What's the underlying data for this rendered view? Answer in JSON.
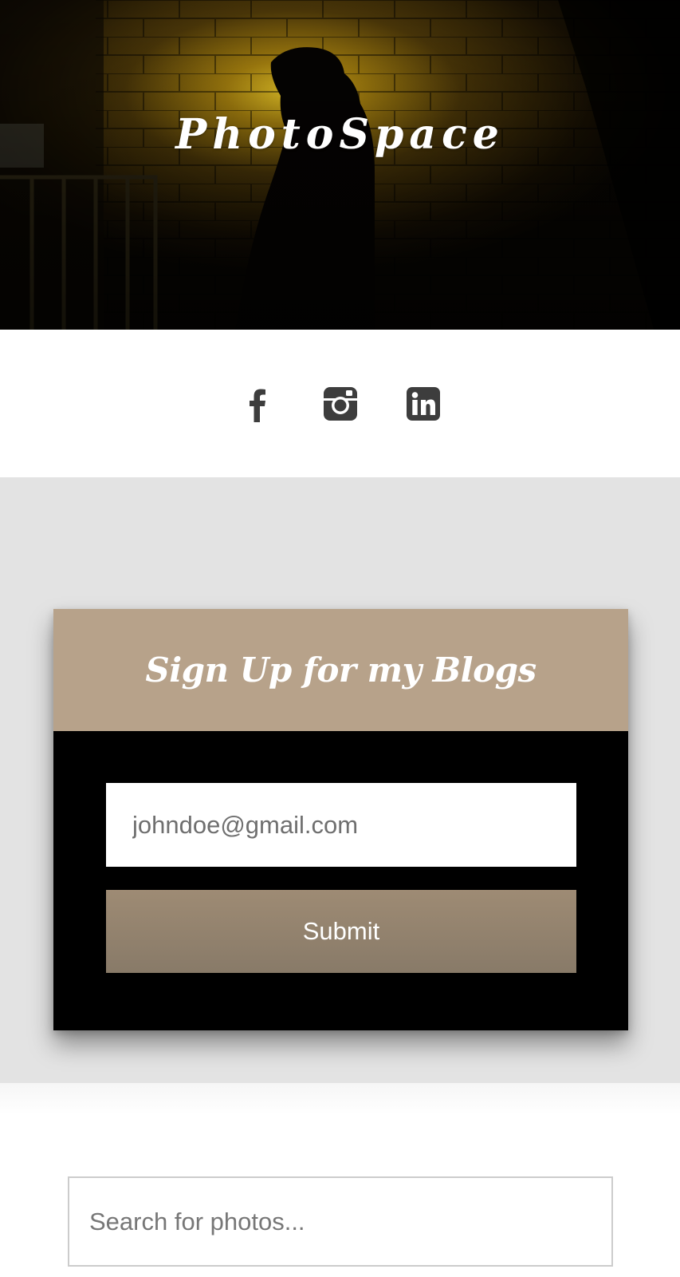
{
  "hero": {
    "title": "PhotoSpace"
  },
  "social": {
    "items": [
      {
        "name": "facebook",
        "icon": "facebook-icon"
      },
      {
        "name": "instagram",
        "icon": "instagram-icon"
      },
      {
        "name": "linkedin",
        "icon": "linkedin-icon"
      }
    ],
    "icon_color": "#3d3d3d"
  },
  "signup": {
    "title": "Sign Up for my Blogs",
    "email_placeholder": "johndoe@gmail.com",
    "submit_label": "Submit"
  },
  "search": {
    "placeholder": "Search for photos..."
  },
  "colors": {
    "accent": "#b7a28a",
    "button": "#928170",
    "card_bg": "#000000",
    "section_bg": "#e3e3e3"
  }
}
